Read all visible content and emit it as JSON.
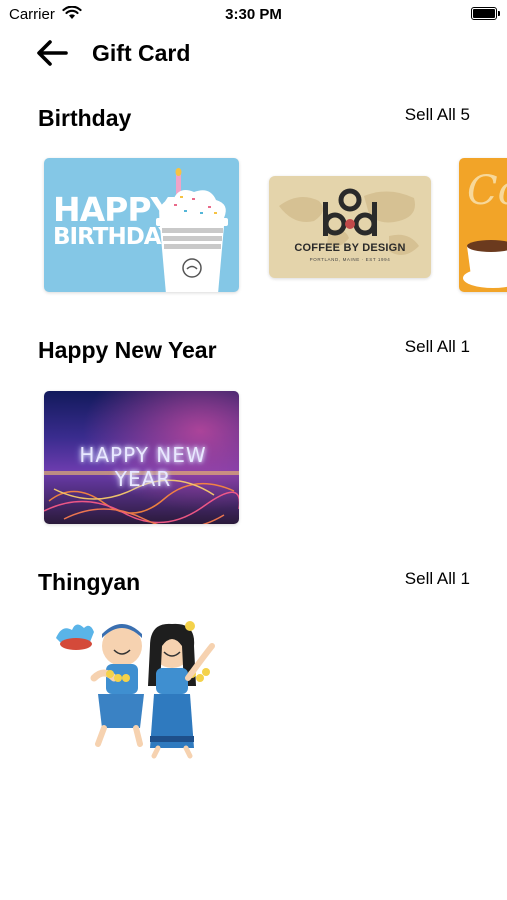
{
  "status_bar": {
    "carrier": "Carrier",
    "time": "3:30 PM"
  },
  "nav": {
    "title": "Gift Card"
  },
  "sections": [
    {
      "title": "Birthday",
      "see_all": "Sell All 5",
      "cards": [
        {
          "art_text_line1": "HAPPY",
          "art_text_line2": "BIRTHDAY"
        },
        {
          "brand": "COFFEE BY DESIGN",
          "sub": "PORTLAND, MAINE · EST 1994"
        },
        {
          "art_text": "Co"
        }
      ]
    },
    {
      "title": "Happy New Year",
      "see_all": "Sell All 1",
      "cards": [
        {
          "art_text": "HAPPY NEW YEAR"
        }
      ]
    },
    {
      "title": "Thingyan",
      "see_all": "Sell All 1",
      "cards": [
        {}
      ]
    }
  ]
}
